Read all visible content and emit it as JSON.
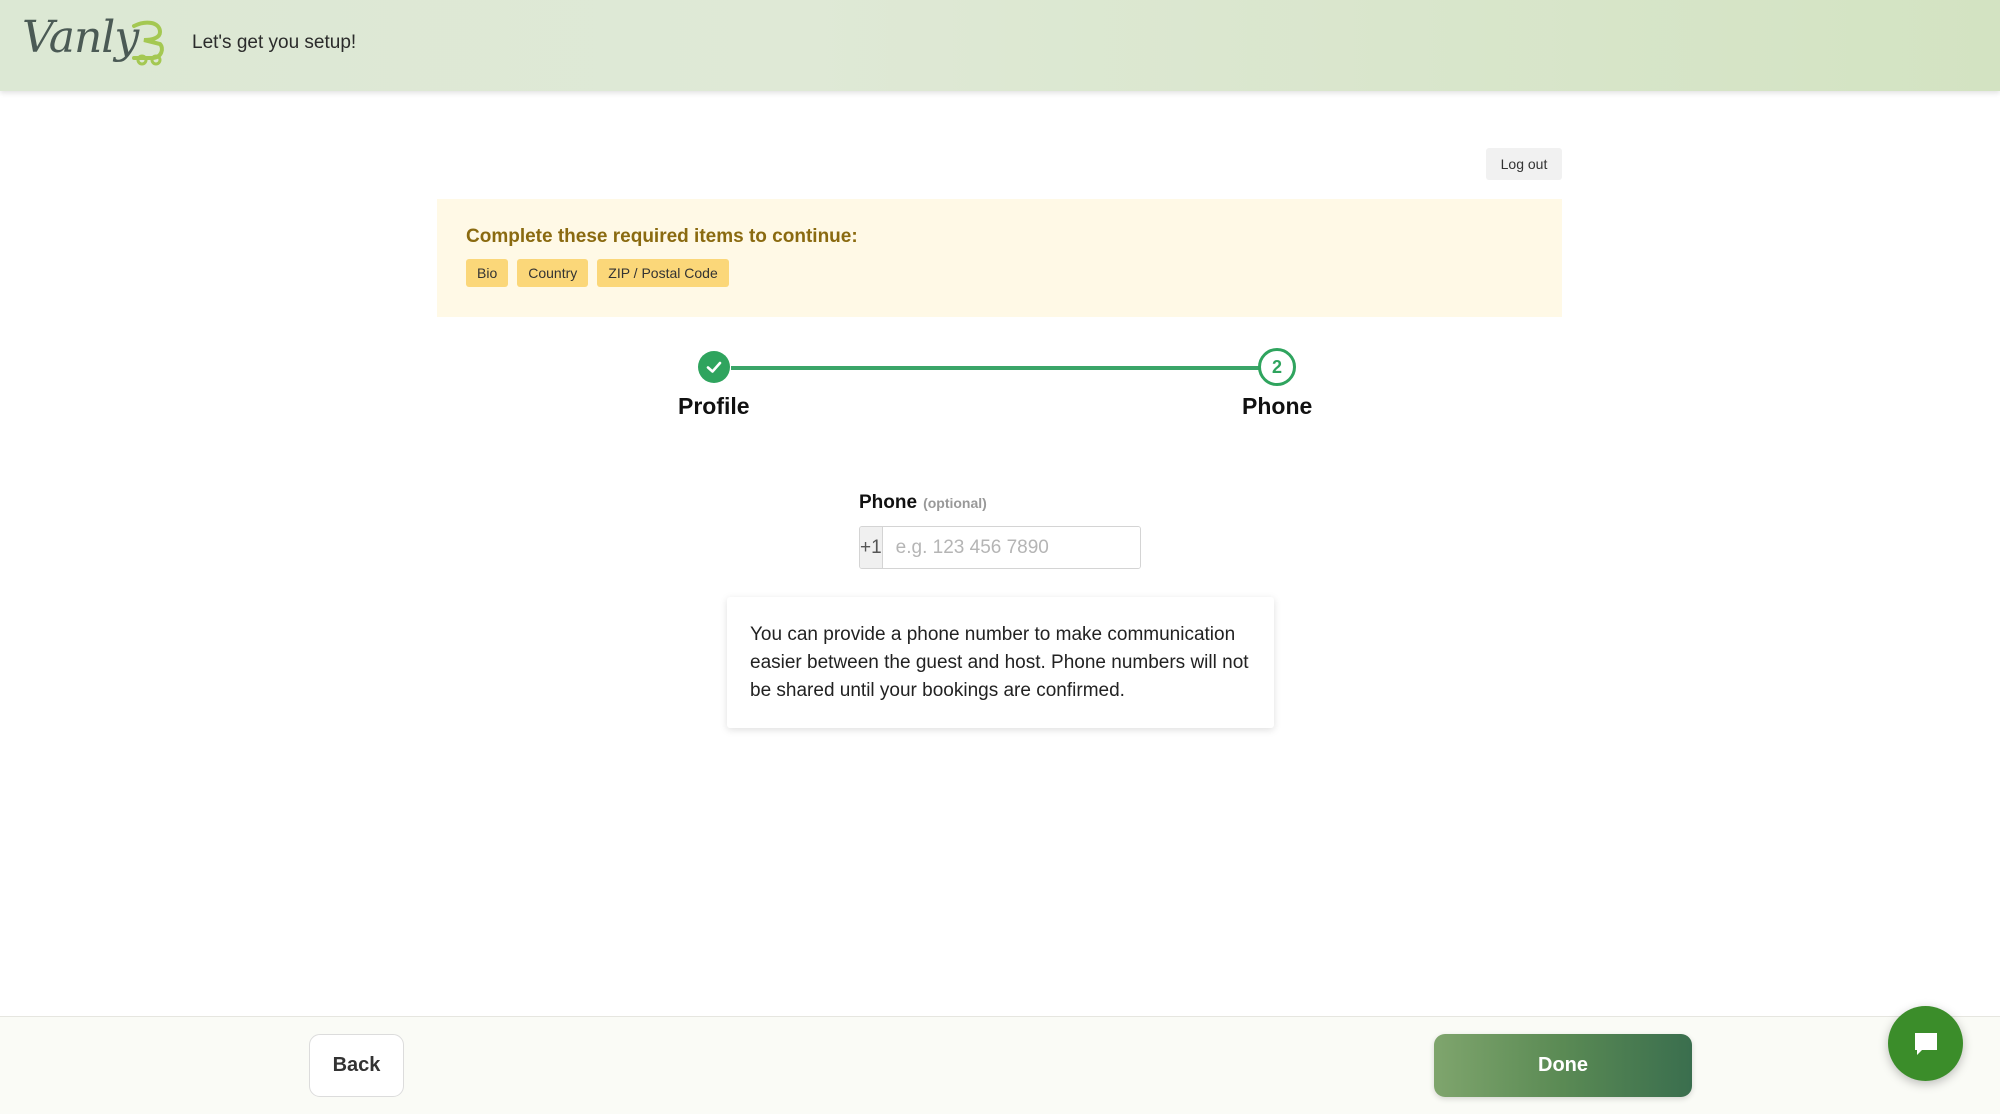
{
  "header": {
    "logo_text": "Vanly",
    "subtitle": "Let's get you setup!"
  },
  "account": {
    "logout_label": "Log out"
  },
  "notice": {
    "title": "Complete these required items to continue:",
    "tags": [
      "Bio",
      "Country",
      "ZIP / Postal Code"
    ]
  },
  "stepper": {
    "steps": [
      {
        "label": "Profile",
        "status": "complete"
      },
      {
        "label": "Phone",
        "number": "2",
        "status": "current"
      }
    ],
    "accent_color": "#2fa45e"
  },
  "phone_field": {
    "label": "Phone",
    "optional_hint": "(optional)",
    "country_code": "+1",
    "placeholder": "e.g. 123 456 7890",
    "value": ""
  },
  "info": {
    "text": "You can provide a phone number to make communication easier between the guest and host. Phone numbers will not be shared until your bookings are confirmed."
  },
  "footer": {
    "back_label": "Back",
    "done_label": "Done"
  },
  "icons": {
    "step_complete": "check-icon",
    "chat": "chat-bubble-icon"
  }
}
